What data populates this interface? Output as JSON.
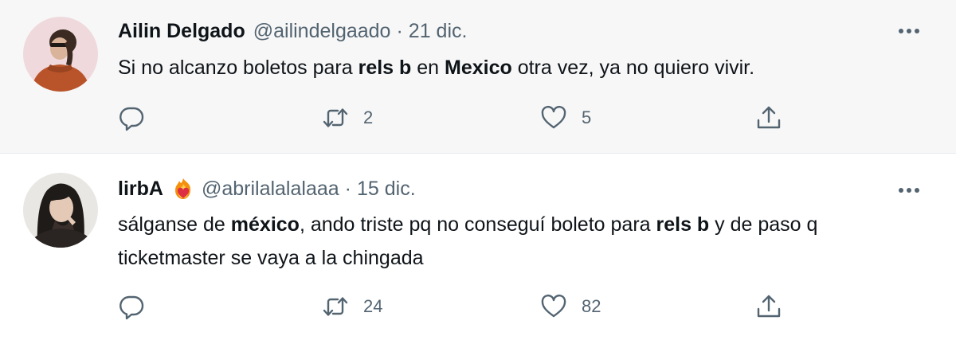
{
  "tweets": [
    {
      "display_name": "Ailin Delgado",
      "handle": "@ailindelgaado",
      "separator": "·",
      "date": "21 dic.",
      "text": {
        "p1": "Si no alcanzo boletos para ",
        "b1": "rels b",
        "p2": " en ",
        "b2": "Mexico",
        "p3": " otra vez, ya no quiero vivir."
      },
      "actions": {
        "reply_icon": "reply-icon",
        "retweet_icon": "retweet-icon",
        "retweet_count": "2",
        "like_icon": "heart-icon",
        "like_count": "5",
        "share_icon": "share-icon"
      },
      "more_icon": "more-icon"
    },
    {
      "display_name": "lirbA",
      "emoji": "heart-on-fire-emoji",
      "handle": "@abrilalalalaaa",
      "separator": "·",
      "date": "15 dic.",
      "text": {
        "p1": "sálganse de ",
        "b1": "méxico",
        "p2": ", ando triste pq no conseguí boleto para ",
        "b2": "rels b",
        "p3": " y de paso q ticketmaster se vaya a la chingada"
      },
      "actions": {
        "reply_icon": "reply-icon",
        "retweet_icon": "retweet-icon",
        "retweet_count": "24",
        "like_icon": "heart-icon",
        "like_count": "82",
        "share_icon": "share-icon"
      },
      "more_icon": "more-icon"
    }
  ],
  "colors": {
    "text_primary": "#0f1419",
    "text_secondary": "#536471",
    "tweet_highlight_bg": "#f7f7f7",
    "divider": "#e6ecf0"
  }
}
